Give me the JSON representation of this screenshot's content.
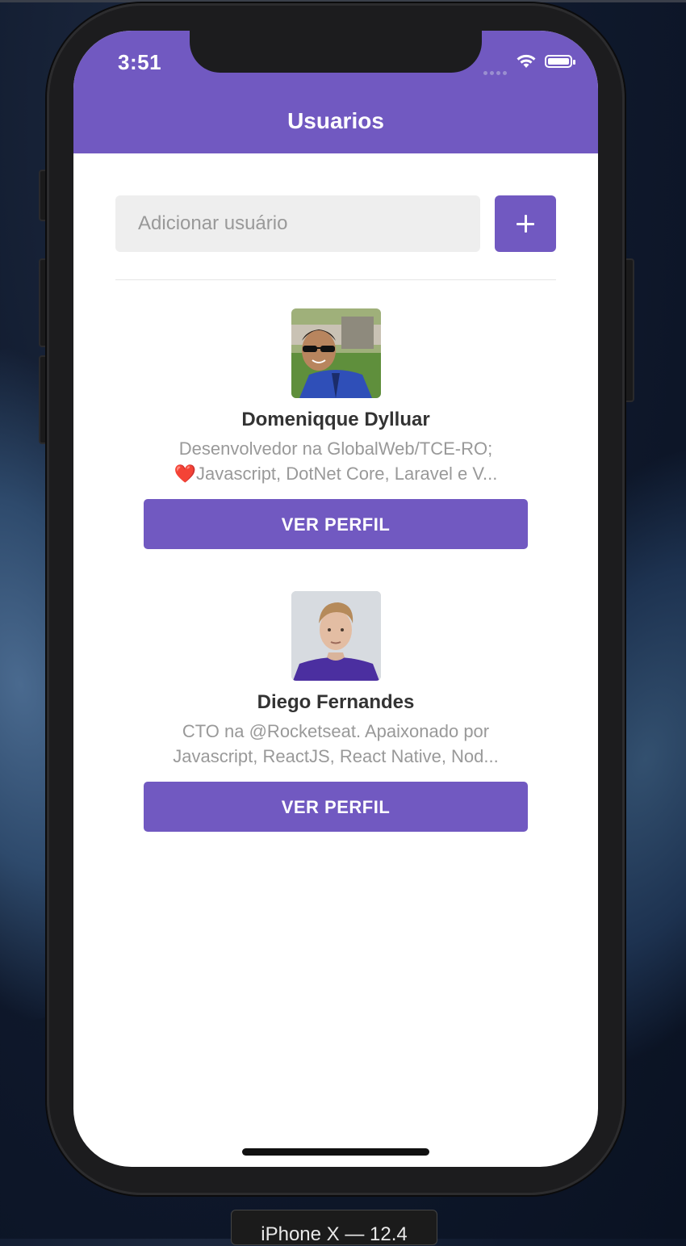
{
  "status_bar": {
    "time": "3:51"
  },
  "header": {
    "title": "Usuarios"
  },
  "form": {
    "placeholder": "Adicionar usuário",
    "value": "",
    "add_icon": "plus-icon"
  },
  "users": [
    {
      "name": "Domeniqque Dylluar",
      "bio_line1": "Desenvolvedor na GlobalWeb/TCE-RO;",
      "bio_line2": "Javascript, DotNet Core, Laravel e V...",
      "bio_emoji": "❤️",
      "button_label": "VER PERFIL"
    },
    {
      "name": "Diego Fernandes",
      "bio_line1": "CTO na @Rocketseat. Apaixonado por",
      "bio_line2": "Javascript, ReactJS, React Native, Nod...",
      "button_label": "VER PERFIL"
    }
  ],
  "simulator": {
    "label": "iPhone X — 12.4"
  },
  "colors": {
    "primary": "#7159c1",
    "input_bg": "#eeeeee",
    "name_text": "#333333",
    "bio_text": "#999999"
  }
}
